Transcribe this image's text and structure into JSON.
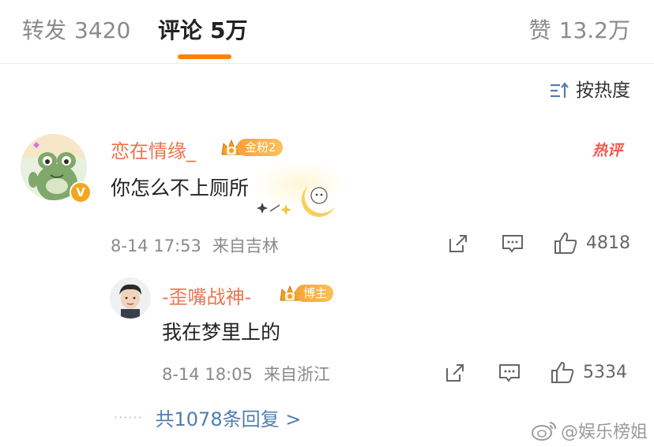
{
  "tabs": {
    "forward": {
      "label": "转发",
      "count": "3420"
    },
    "comments": {
      "label": "评论",
      "count": "5万"
    },
    "likes": {
      "label": "赞",
      "count": "13.2万"
    }
  },
  "sort": {
    "label": "按热度"
  },
  "comment": {
    "username": "恋在情缘_",
    "fan_badge": "金粉2",
    "hot_tag": "热评",
    "text": "你怎么不上厕所",
    "time": "8-14 17:53",
    "location": "来自吉林",
    "like_count": "4818"
  },
  "reply": {
    "username": "-歪嘴战神-",
    "author_badge": "博主",
    "text": "我在梦里上的",
    "time": "8-14 18:05",
    "location": "来自浙江",
    "like_count": "5334"
  },
  "more_replies": {
    "dots": "······",
    "label": "共1078条回复 >"
  },
  "watermark": {
    "text": "@娱乐榜姐"
  },
  "colors": {
    "accent": "#ff8200",
    "username": "#eb7350",
    "link": "#507daf",
    "hot": "#f05a4d"
  }
}
